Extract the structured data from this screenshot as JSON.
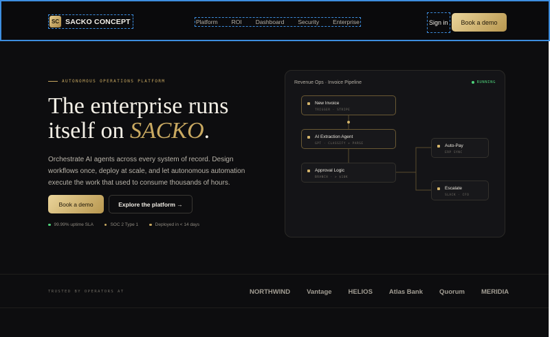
{
  "header": {
    "logo_mark": "SC",
    "brand": "SACKO CONCEPT",
    "nav": [
      "Platform",
      "ROI",
      "Dashboard",
      "Security",
      "Enterprise"
    ],
    "signin": "Sign in",
    "cta": "Book a demo"
  },
  "hero": {
    "eyebrow": "AUTONOMOUS OPERATIONS PLATFORM",
    "headline_line1": "The enterprise runs",
    "headline_line2_prefix": "itself on ",
    "headline_brand": "SACKO",
    "headline_suffix": ".",
    "lede": "Orchestrate AI agents across every system of record. Design workflows once, deploy at scale, and let autonomous automation execute the work that used to consume thousands of hours.",
    "primary_cta": "Book a demo",
    "secondary_cta": "Explore the platform →",
    "stats": [
      {
        "label": "99.99% uptime SLA",
        "color": "#4fd27b"
      },
      {
        "label": "SOC 2 Type 1",
        "color": "#c9a961"
      },
      {
        "label": "Deployed in < 14 days",
        "color": "#c9a961"
      }
    ]
  },
  "pipeline": {
    "title": "Revenue Ops · Invoice Pipeline",
    "status": "RUNNING",
    "nodes": [
      {
        "title": "New Invoice",
        "meta": "TRIGGER · STRIPE"
      },
      {
        "title": "AI Extraction Agent",
        "meta": "GPT · CLASSIFY + PARSE"
      },
      {
        "title": "Approval Logic",
        "meta": "BRANCH · > $10K"
      },
      {
        "title": "Auto-Pay",
        "meta": "ERP SYNC"
      },
      {
        "title": "Escalate",
        "meta": "SLACK · CFO"
      }
    ]
  },
  "trust": {
    "label": "TRUSTED BY OPERATORS AT",
    "brands": [
      "NORTHWIND",
      "Vantage",
      "HELIOS",
      "Atlas Bank",
      "Quorum",
      "MERIDIA"
    ]
  },
  "colors": {
    "accent": "#c9a961",
    "status_green": "#4fd27b",
    "background": "#0d0d0f"
  }
}
